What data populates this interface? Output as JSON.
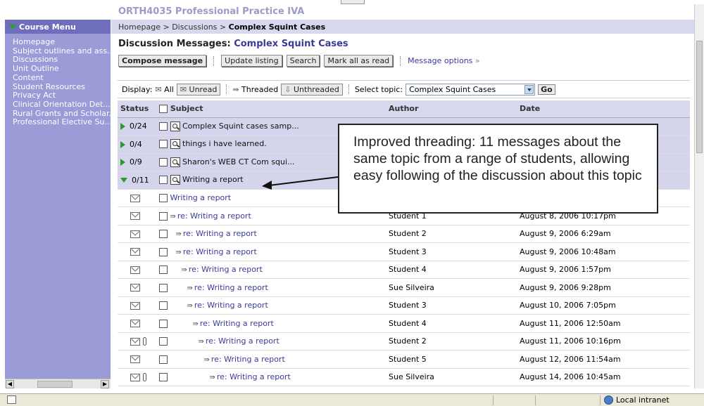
{
  "course_title": "ORTH4035 Professional Practice IVA",
  "sidebar": {
    "header": "Course Menu",
    "items": [
      "Homepage",
      "Subject outlines and ass...",
      "Discussions",
      "Unit Outline",
      "Content",
      "Student Resources",
      "Privacy Act",
      "Clinical Orientation Det...",
      "Rural Grants and Scholar...",
      "Professional Elective Su..."
    ]
  },
  "breadcrumb": {
    "home": "Homepage",
    "sep": ">",
    "discussions": "Discussions",
    "current": "Complex Squint Cases"
  },
  "page_title": {
    "prefix": "Discussion Messages:",
    "topic": "Complex Squint Cases"
  },
  "toolbar": {
    "compose": "Compose message",
    "update": "Update listing",
    "search": "Search",
    "mark_all": "Mark all as read",
    "options": "Message options",
    "options_chevron": "»"
  },
  "filter": {
    "display_label": "Display:",
    "all": "All",
    "unread": "Unread",
    "threaded": "Threaded",
    "unthreaded": "Unthreaded",
    "topic_label": "Select topic:",
    "topic_value": "Complex Squint Cases",
    "go": "Go"
  },
  "table": {
    "headers": [
      "Status",
      "Subject",
      "Author",
      "Date"
    ],
    "parents": [
      {
        "status": "0/24",
        "subject": "Complex Squint cases samp..."
      },
      {
        "status": "0/4",
        "subject": "things i have learned."
      },
      {
        "status": "0/9",
        "subject": "Sharon's WEB CT Com squi..."
      },
      {
        "status": "0/11",
        "subject": "Writing a report"
      }
    ],
    "children": [
      {
        "subject": "Writing a report",
        "author": "",
        "date": ""
      },
      {
        "subject": "re: Writing a report",
        "author": "Student 1",
        "date": "August 8, 2006 10:17pm"
      },
      {
        "subject": "re: Writing a report",
        "author": "Student 2",
        "date": "August 9, 2006 6:29am"
      },
      {
        "subject": "re: Writing a report",
        "author": "Student 3",
        "date": "August 9, 2006 10:48am"
      },
      {
        "subject": "re: Writing a report",
        "author": "Student 4",
        "date": "August 9, 2006 1:57pm"
      },
      {
        "subject": "re: Writing a report",
        "author": "Sue Silveira",
        "date": "August 9, 2006 9:28pm"
      },
      {
        "subject": "re: Writing a report",
        "author": "Student 3",
        "date": "August 10, 2006 7:05pm"
      },
      {
        "subject": "re: Writing a report",
        "author": "Student 4",
        "date": "August 11, 2006 12:50am"
      },
      {
        "subject": "re: Writing a report",
        "author": "Student 2",
        "date": "August 11, 2006 10:16pm"
      },
      {
        "subject": "re: Writing a report",
        "author": "Student 5",
        "date": "August 12, 2006 11:54am"
      },
      {
        "subject": "re: Writing a report",
        "author": "Sue Silveira",
        "date": "August 14, 2006 10:45am"
      }
    ]
  },
  "callout": {
    "text": "Improved threading: 11 messages about the same topic from a range of students, allowing easy following of the discussion about this topic"
  },
  "statusbar": {
    "zone": "Local intranet"
  },
  "colors": {
    "sidebar_bg": "#9b9bd7",
    "header_band": "#d8d8ee",
    "link": "#3a3a9a",
    "expand_icon": "#2a9a2a"
  }
}
